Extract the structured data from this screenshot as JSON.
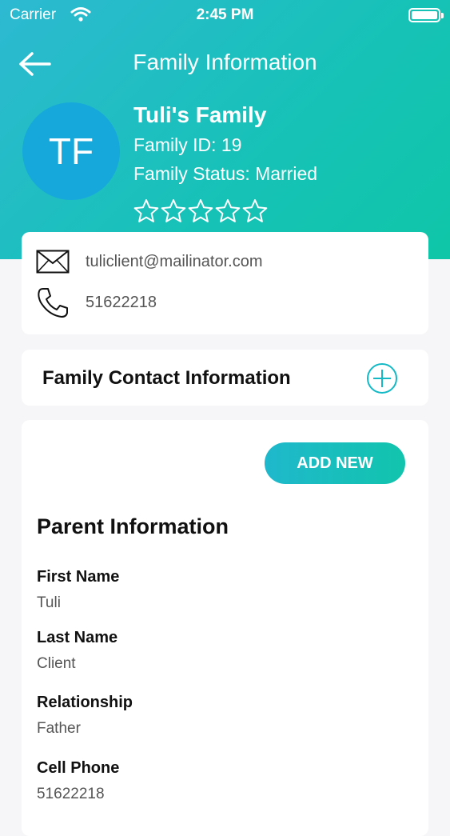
{
  "status_bar": {
    "carrier": "Carrier",
    "time": "2:45 PM"
  },
  "nav": {
    "title": "Family Information",
    "back_icon": "arrow-left-icon"
  },
  "profile": {
    "initials": "TF",
    "family_name": "Tuli's Family",
    "family_id": "Family ID: 19",
    "family_status": "Family Status: Married",
    "rating": 0,
    "rating_max": 5
  },
  "contact": {
    "email": "tuliclient@mailinator.com",
    "phone": "51622218"
  },
  "family_contact": {
    "title": "Family Contact Information"
  },
  "parent": {
    "add_new_label": "ADD NEW",
    "section_title": "Parent Information",
    "fields": [
      {
        "label": "First Name",
        "value": "Tuli"
      },
      {
        "label": "Last Name",
        "value": "Client"
      },
      {
        "label": "Relationship",
        "value": "Father"
      },
      {
        "label": "Cell Phone",
        "value": "51622218"
      }
    ]
  },
  "colors": {
    "accent": "#14c0b5",
    "avatar": "#16a8db"
  }
}
